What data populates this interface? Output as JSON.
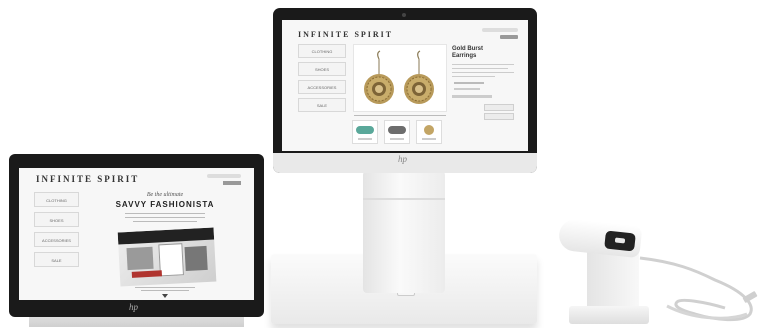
{
  "large_screen": {
    "brand": "INFINITE SPIRIT",
    "nav": [
      "CLOTHING",
      "SHOES",
      "ACCESSORIES",
      "SALE"
    ],
    "product": {
      "title_line1": "Gold Burst",
      "title_line2": "Earrings"
    }
  },
  "small_screen": {
    "brand": "INFINITE SPIRIT",
    "nav": [
      "CLOTHING",
      "SHOES",
      "ACCESSORIES",
      "SALE"
    ],
    "promo": {
      "line1": "Be the ultimate",
      "line2": "SAVVY FASHIONISTA"
    }
  },
  "logos": {
    "hp": "hp"
  },
  "colors": {
    "bezel": "#1a1a1a",
    "screen_bg": "#f7f7f7",
    "stand": "#f3f3f3",
    "earring_gold": "#b89a5a",
    "scanner_screen": "#222222"
  }
}
